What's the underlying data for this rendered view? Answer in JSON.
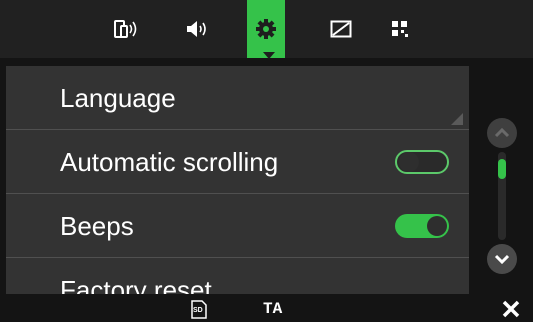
{
  "top_tabs": [
    {
      "icon": "device-signal-icon",
      "active": false
    },
    {
      "icon": "speaker-volume-icon",
      "active": false
    },
    {
      "icon": "gear-icon",
      "active": true
    },
    {
      "icon": "display-brightness-icon",
      "active": false
    },
    {
      "icon": "grid-apps-icon",
      "active": false
    }
  ],
  "settings": {
    "items": [
      {
        "label": "Language",
        "control": "submenu"
      },
      {
        "label": "Automatic scrolling",
        "control": "toggle",
        "value": false
      },
      {
        "label": "Beeps",
        "control": "toggle",
        "value": true
      },
      {
        "label": "Factory reset",
        "control": "action"
      }
    ]
  },
  "scrollbar": {
    "position": 0.1
  },
  "bottom": {
    "sd_label": "SD",
    "ta_label": "TA"
  },
  "colors": {
    "accent": "#35c24a",
    "panel": "#333333",
    "bar": "#212121",
    "background": "#141414"
  }
}
